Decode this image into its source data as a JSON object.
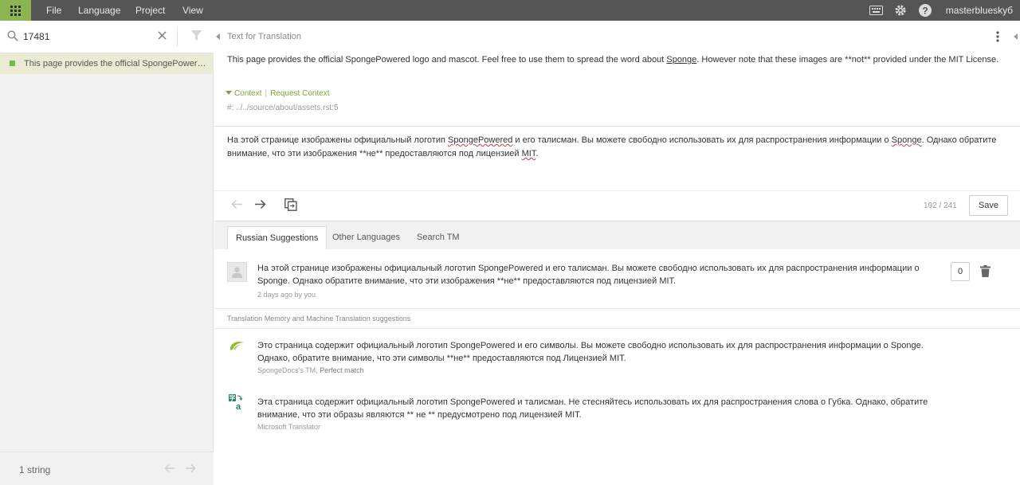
{
  "topbar": {
    "menu": [
      "File",
      "Language",
      "Project",
      "View"
    ],
    "username": "masterblueskyб"
  },
  "sidebar": {
    "search_value": "17481",
    "string_item": "This page provides the official SpongePowered ...",
    "footer_count": "1 string"
  },
  "source": {
    "section_title": "Text for Translation",
    "text_before": "This page provides the official SpongePowered logo and mascot. Feel free to use them to spread the word about ",
    "text_word": "Sponge",
    "text_after": ". However note that these images are **not** provided under the MIT License.",
    "context_label": "Context",
    "request_context_label": "Request Context",
    "path": "#: ../../source/about/assets.rst:5"
  },
  "editor": {
    "t1": "На этой странице изображены официальный логотип ",
    "t2": "SpongePowered",
    "t3": " и его талисман. Вы можете свободно использовать их для распространения информации о ",
    "t4": "Sponge",
    "t5": ". Однако обратите внимание, что эти изображения **не** предоставляются под лицензией ",
    "t6": "MIT",
    "t7": ".",
    "char_count": "192 / 241",
    "save_label": "Save"
  },
  "tabs": [
    "Russian Suggestions",
    "Other Languages",
    "Search TM"
  ],
  "suggestions": {
    "own": {
      "text": "На этой странице изображены официальный логотип SpongePowered и его талисман. Вы можете свободно использовать их для распространения информации о Sponge. Однако обратите внимание, что эти изображения **не** предоставляются под лицензией MIT.",
      "meta": "2 days ago by you",
      "votes": "0"
    },
    "tm_header": "Translation Memory and Machine Translation suggestions",
    "tm": {
      "text": "Это страница содержит официальный логотип SpongePowered и его символы. Вы можете свободно использовать их для распространения информации о Sponge. Однако, обратите внимание, что эти символы **не** предоставляются под Лицензией MIT.",
      "source": "SpongeDocs's TM,",
      "match": "Perfect match"
    },
    "mt": {
      "text": "Эта страница содержит официальный логотип SpongePowered и талисман. Не стесняйтесь использовать их для распространения слова о Губка. Однако, обратите внимание, что эти образы являются ** не ** предусмотрено под лицензией MIT.",
      "source": "Microsoft Translator"
    }
  },
  "colors": {
    "accent_green": "#8cb552",
    "topbar_bg": "#555555",
    "selected_item_bg": "#ebebd3"
  }
}
